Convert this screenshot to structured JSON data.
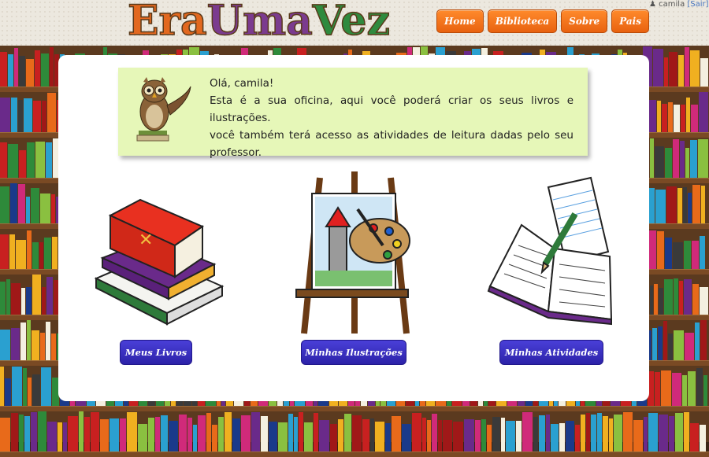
{
  "brand": {
    "part1": "Era",
    "part2": "Uma",
    "part3": "Vez"
  },
  "nav": [
    "Home",
    "Biblioteca",
    "Sobre",
    "Pais"
  ],
  "user": {
    "name": "camila",
    "logout": "[Sair]"
  },
  "welcome": {
    "greeting": "Olá, camila!",
    "line1": "Esta é a sua oficina, aqui você poderá criar os seus livros e ilustrações.",
    "line2": "você também terá acesso as atividades de leitura dadas pelo seu professor."
  },
  "cards": [
    {
      "label": "Meus Livros",
      "icon": "book-stack-icon"
    },
    {
      "label": "Minhas Ilustrações",
      "icon": "easel-painting-icon"
    },
    {
      "label": "Minhas Atividades",
      "icon": "notebook-pencil-icon"
    }
  ]
}
